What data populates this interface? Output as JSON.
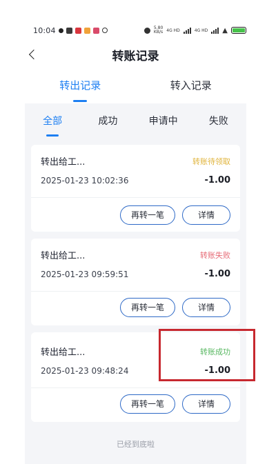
{
  "statusbar": {
    "time": "10:04",
    "net_speed_top": "5.80",
    "net_speed_unit": "KB/s",
    "signal_1": "4G HD",
    "signal_2": "4G HD",
    "battery_color": "#46c24a"
  },
  "nav": {
    "title": "转账记录",
    "back_icon": "back-chevron-icon"
  },
  "top_tabs": [
    {
      "label": "转出记录",
      "active": true
    },
    {
      "label": "转入记录",
      "active": false
    }
  ],
  "sub_tabs": [
    {
      "label": "全部",
      "active": true
    },
    {
      "label": "成功",
      "active": false
    },
    {
      "label": "申请中",
      "active": false
    },
    {
      "label": "失败",
      "active": false
    }
  ],
  "records": [
    {
      "name": "转出给工...",
      "status": "转账待领取",
      "status_color": "#e0b43c",
      "datetime": "2025-01-23 10:02:36",
      "amount": "-1.00",
      "btn_again": "再转一笔",
      "btn_detail": "详情"
    },
    {
      "name": "转出给工...",
      "status": "转账失败",
      "status_color": "#e66a75",
      "datetime": "2025-01-23 09:59:51",
      "amount": "-1.00",
      "btn_again": "再转一笔",
      "btn_detail": "详情"
    },
    {
      "name": "转出给工...",
      "status": "转账成功",
      "status_color": "#59b862",
      "datetime": "2025-01-23 09:48:24",
      "amount": "-1.00",
      "btn_again": "再转一笔",
      "btn_detail": "详情"
    }
  ],
  "footer": "已经到底啦",
  "accent_color": "#1d7ff2",
  "highlight_color": "#c7282f"
}
